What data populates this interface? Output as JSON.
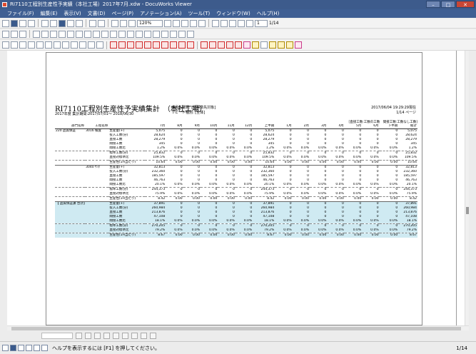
{
  "window": {
    "title": "RI7110工程別生産性予実績（本社工場）2017年7月.xdw - DocuWorks Viewer",
    "buttons": [
      "–",
      "□",
      "✕"
    ]
  },
  "menu": [
    "ファイル(F)",
    "編集(E)",
    "表示(V)",
    "文書(D)",
    "ページ(P)",
    "アノテーション(A)",
    "ツール(T)",
    "ウィンドウ(W)",
    "ヘルプ(H)"
  ],
  "toolbar": {
    "zoom": "120%",
    "page": "1",
    "total": "1/14"
  },
  "report": {
    "title": "RI7110工程別生産性予実績集計　（本社工場）",
    "period": "2017年度 集計期間:2017/07/01～ 2018/06/30",
    "mid1": "商品先選択: [全得意先対象]",
    "mid2": "リピート種別: [全体]",
    "right1": "2017/06/04 19:29:29現在",
    "right2": "1/14 ページ",
    "cond": "[直接工数:工数の工数　間接工数:工数なし工数]",
    "headers": [
      "部門名称",
      "工程名称",
      "",
      "7月",
      "8月",
      "9月",
      "10月",
      "11月",
      "12月",
      "上半期",
      "1月",
      "2月",
      "3月",
      "4月",
      "5月",
      "6月",
      "下半期",
      "総計"
    ],
    "rows": [
      [
        "220 品質保証",
        "3016 検査",
        "生産量(+)",
        "5,075",
        "0",
        "0",
        "0",
        "0",
        "0",
        "5,075",
        "0",
        "0",
        "0",
        "0",
        "0",
        "0",
        "0",
        "5,075"
      ],
      [
        "",
        "",
        "投入工数(分)",
        "28,624",
        "0",
        "0",
        "0",
        "0",
        "0",
        "28,624",
        "0",
        "0",
        "0",
        "0",
        "0",
        "0",
        "0",
        "28,624"
      ],
      [
        "",
        "",
        "直接工数",
        "28,279",
        "0",
        "0",
        "0",
        "0",
        "0",
        "28,279",
        "0",
        "0",
        "0",
        "0",
        "0",
        "0",
        "0",
        "28,279"
      ],
      [
        "",
        "",
        "間接工数",
        "345",
        "0",
        "0",
        "0",
        "0",
        "0",
        "345",
        "0",
        "0",
        "0",
        "0",
        "0",
        "0",
        "0",
        "345"
      ],
      [
        "",
        "",
        "間接工数比",
        "1.2%",
        "0.0%",
        "0.0%",
        "0.0%",
        "0.0%",
        "0.0%",
        "1.2%",
        "0.0%",
        "0.0%",
        "0.0%",
        "0.0%",
        "0.0%",
        "0.0%",
        "0.0%",
        "1.2%"
      ],
      [
        "",
        "",
        "標準工数(分)",
        "25,832",
        "0",
        "0",
        "0",
        "0",
        "0",
        "25,832",
        "0",
        "0",
        "0",
        "0",
        "0",
        "0",
        "0",
        "25,832"
      ],
      [
        "",
        "",
        "直接対標準比",
        "109.5%",
        "0.0%",
        "0.0%",
        "0.0%",
        "0.0%",
        "0.0%",
        "109.5%",
        "0.0%",
        "0.0%",
        "0.0%",
        "0.0%",
        "0.0%",
        "0.0%",
        "0.0%",
        "109.5%"
      ],
      [
        "",
        "",
        "生産性(1H当たり)",
        "10.64",
        "0.00",
        "0.00",
        "0.00",
        "0.00",
        "0.00",
        "10.64",
        "0.00",
        "0.00",
        "0.00",
        "0.00",
        "0.00",
        "0.00",
        "0.00",
        "10.64"
      ],
      [
        "",
        "3040 ｻﾝﾀﾞ",
        "生産量(+)",
        "32,813",
        "0",
        "0",
        "0",
        "0",
        "0",
        "32,813",
        "0",
        "0",
        "0",
        "0",
        "0",
        "0",
        "0",
        "32,813"
      ],
      [
        "",
        "",
        "投入工数(分)",
        "232,360",
        "0",
        "0",
        "0",
        "0",
        "0",
        "232,360",
        "0",
        "0",
        "0",
        "0",
        "0",
        "0",
        "0",
        "232,360"
      ],
      [
        "",
        "",
        "直接工数",
        "185,597",
        "0",
        "0",
        "0",
        "0",
        "0",
        "185,597",
        "0",
        "0",
        "0",
        "0",
        "0",
        "0",
        "0",
        "185,597"
      ],
      [
        "",
        "",
        "間接工数",
        "46,763",
        "0",
        "0",
        "0",
        "0",
        "0",
        "46,763",
        "0",
        "0",
        "0",
        "0",
        "0",
        "0",
        "0",
        "46,763"
      ],
      [
        "",
        "",
        "間接工数比",
        "20.1%",
        "0.0%",
        "0.0%",
        "0.0%",
        "0.0%",
        "0.0%",
        "20.1%",
        "0.0%",
        "0.0%",
        "0.0%",
        "0.0%",
        "0.0%",
        "0.0%",
        "0.0%",
        "20.1%"
      ],
      [
        "",
        "",
        "標準工数(分)",
        "244,373",
        "0",
        "0",
        "0",
        "0",
        "0",
        "244,373",
        "0",
        "0",
        "0",
        "0",
        "0",
        "0",
        "0",
        "244,373"
      ],
      [
        "",
        "",
        "直接対標準比",
        "75.9%",
        "0.0%",
        "0.0%",
        "0.0%",
        "0.0%",
        "0.0%",
        "75.9%",
        "0.0%",
        "0.0%",
        "0.0%",
        "0.0%",
        "0.0%",
        "0.0%",
        "0.0%",
        "75.9%"
      ],
      [
        "",
        "",
        "生産性(1H当たり)",
        "8.42",
        "0.00",
        "0.00",
        "0.00",
        "0.00",
        "0.00",
        "8.42",
        "0.00",
        "0.00",
        "0.00",
        "0.00",
        "0.00",
        "0.00",
        "0.00",
        "8.42"
      ],
      [
        "【 品質保証課 合計】",
        "",
        "生産量(+)",
        "37,891",
        "0",
        "0",
        "0",
        "0",
        "0",
        "37,891",
        "0",
        "0",
        "0",
        "0",
        "0",
        "0",
        "0",
        "37,891"
      ],
      [
        "",
        "",
        "投入工数(分)",
        "260,984",
        "0",
        "0",
        "0",
        "0",
        "0",
        "260,984",
        "0",
        "0",
        "0",
        "0",
        "0",
        "0",
        "0",
        "260,984"
      ],
      [
        "",
        "",
        "直接工数",
        "213,876",
        "0",
        "0",
        "0",
        "0",
        "0",
        "213,876",
        "0",
        "0",
        "0",
        "0",
        "0",
        "0",
        "0",
        "213,876"
      ],
      [
        "",
        "",
        "間接工数",
        "47,108",
        "0",
        "0",
        "0",
        "0",
        "0",
        "47,108",
        "0",
        "0",
        "0",
        "0",
        "0",
        "0",
        "0",
        "47,108"
      ],
      [
        "",
        "",
        "間接工数比",
        "18.1%",
        "0.0%",
        "0.0%",
        "0.0%",
        "0.0%",
        "0.0%",
        "18.1%",
        "0.0%",
        "0.0%",
        "0.0%",
        "0.0%",
        "0.0%",
        "0.0%",
        "0.0%",
        "18.1%"
      ],
      [
        "",
        "",
        "標準工数(分)",
        "270,205",
        "0",
        "0",
        "0",
        "0",
        "0",
        "270,205",
        "0",
        "0",
        "0",
        "0",
        "0",
        "0",
        "0",
        "270,205"
      ],
      [
        "",
        "",
        "直接対標準比",
        "79.2%",
        "0.0%",
        "0.0%",
        "0.0%",
        "0.0%",
        "0.0%",
        "79.2%",
        "0.0%",
        "0.0%",
        "0.0%",
        "0.0%",
        "0.0%",
        "0.0%",
        "0.0%",
        "79.2%"
      ],
      [
        "",
        "",
        "生産性(1H当たり)",
        "8.67",
        "0.00",
        "0.00",
        "0.00",
        "0.00",
        "0.00",
        "8.67",
        "0.00",
        "0.00",
        "0.00",
        "0.00",
        "0.00",
        "0.00",
        "0.00",
        "8.67"
      ]
    ]
  },
  "status": {
    "message": "ヘルプを表示するには [F1] を押してください。",
    "page": "1/14"
  }
}
